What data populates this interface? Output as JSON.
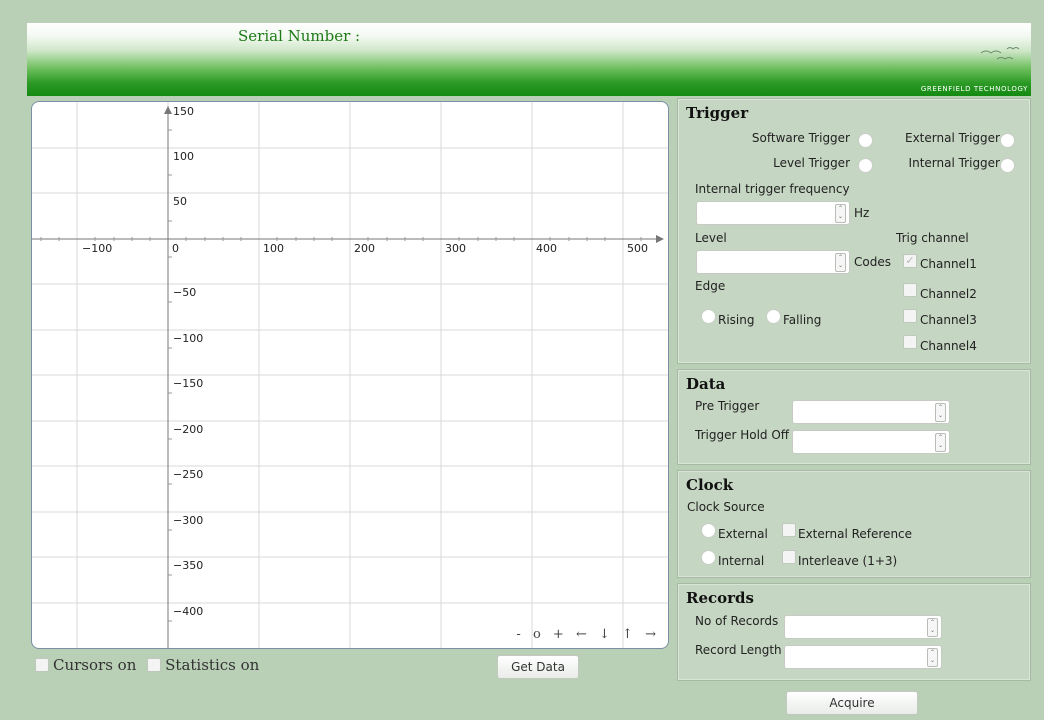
{
  "header": {
    "serial_label": "Serial Number :",
    "brand": "GREENFIELD TECHNOLOGY"
  },
  "plot": {
    "x_ticks": [
      "−100",
      "0",
      "100",
      "200",
      "300",
      "400",
      "500"
    ],
    "y_ticks": [
      "150",
      "100",
      "50",
      "−50",
      "−100",
      "−150",
      "−200",
      "−250",
      "−300",
      "−350",
      "−400"
    ],
    "nav": [
      "-",
      "o",
      "+",
      "←",
      "↓",
      "↑",
      "→"
    ]
  },
  "below": {
    "cursors_label": "Cursors on",
    "statistics_label": "Statistics on",
    "get_data_label": "Get Data"
  },
  "trigger": {
    "title": "Trigger",
    "software": "Software Trigger",
    "external": "External Trigger",
    "level_trigger": "Level Trigger",
    "internal": "Internal Trigger",
    "freq_label": "Internal trigger frequency",
    "freq_unit": "Hz",
    "level_label": "Level",
    "level_unit": "Codes",
    "trig_channel_label": "Trig channel",
    "channels": [
      "Channel1",
      "Channel2",
      "Channel3",
      "Channel4"
    ],
    "edge_label": "Edge",
    "rising": "Rising",
    "falling": "Falling"
  },
  "data": {
    "title": "Data",
    "pre_trigger": "Pre Trigger",
    "hold_off": "Trigger Hold Off"
  },
  "clock": {
    "title": "Clock",
    "source_label": "Clock Source",
    "external": "External",
    "ext_ref": "External Reference",
    "internal": "Internal",
    "interleave": "Interleave (1+3)"
  },
  "records": {
    "title": "Records",
    "no_of_records": "No of Records",
    "record_length": "Record Length"
  },
  "acquire_label": "Acquire"
}
